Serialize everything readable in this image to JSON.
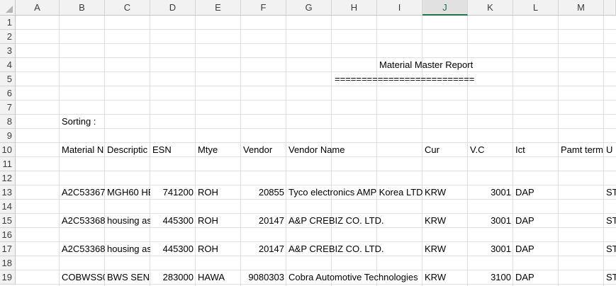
{
  "columns": [
    "A",
    "B",
    "C",
    "D",
    "E",
    "F",
    "G",
    "H",
    "I",
    "J",
    "K",
    "L",
    "M",
    ""
  ],
  "selected_column": "J",
  "rows": [
    "1",
    "2",
    "3",
    "4",
    "5",
    "6",
    "7",
    "8",
    "9",
    "10",
    "11",
    "12",
    "13",
    "14",
    "15",
    "16",
    "17",
    "18",
    "19"
  ],
  "report": {
    "title": "Material Master Report",
    "underline": "==========================",
    "sorting_label": "Sorting :"
  },
  "headers": {
    "material": "Material N",
    "description": "Descriptic",
    "esn": "ESN",
    "mtye": "Mtye",
    "vendor": "Vendor",
    "vendor_name": "Vendor Name",
    "cur": "Cur",
    "vc": "V.C",
    "ict": "Ict",
    "pamt_term": "Pamt term",
    "u": "U"
  },
  "data_rows": [
    {
      "material": "A2C53367(",
      "description": "MGH60 HE",
      "esn": "741200",
      "mtye": "ROH",
      "vendor": "20855",
      "vendor_name": "Tyco electronics AMP Korea LTD",
      "cur": "KRW",
      "vc": "3001",
      "ict": "DAP",
      "u": "ST"
    },
    {
      "material": "A2C53368(",
      "description": "housing as",
      "esn": "445300",
      "mtye": "ROH",
      "vendor": "20147",
      "vendor_name": "A&P CREBIZ CO. LTD.",
      "cur": "KRW",
      "vc": "3001",
      "ict": "DAP",
      "u": "ST"
    },
    {
      "material": "A2C53368(",
      "description": "housing as",
      "esn": "445300",
      "mtye": "ROH",
      "vendor": "20147",
      "vendor_name": "A&P CREBIZ CO. LTD.",
      "cur": "KRW",
      "vc": "3001",
      "ict": "DAP",
      "u": "ST"
    },
    {
      "material": "COBWSS0",
      "description": "BWS SENS",
      "esn": "283000",
      "mtye": "HAWA",
      "vendor": "9080303",
      "vendor_name": "Cobra Automotive Technologies",
      "cur": "KRW",
      "vc": "3100",
      "ict": "DAP",
      "u": "ST"
    }
  ]
}
